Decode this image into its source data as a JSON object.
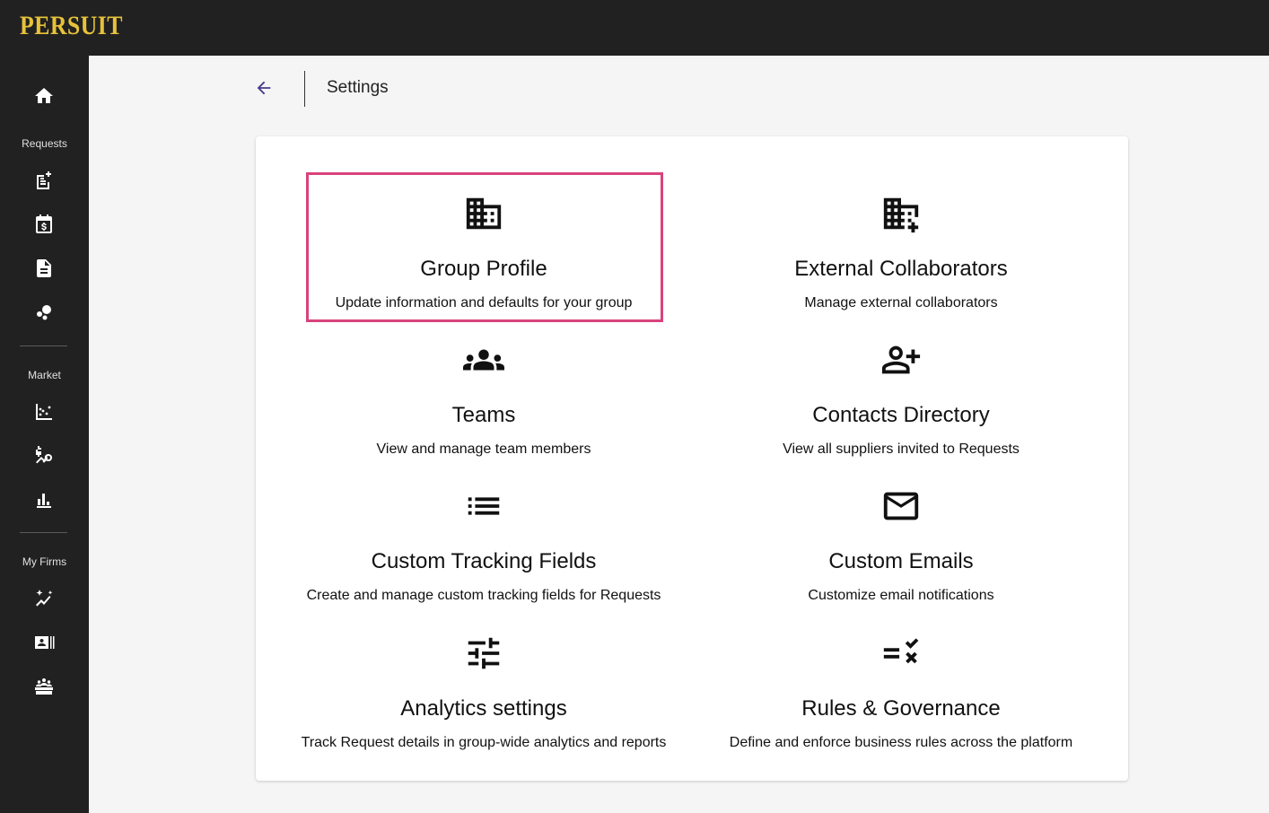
{
  "app": {
    "logo": "PERSUIT"
  },
  "sidebar": {
    "home_icon": "home-icon",
    "sections": [
      {
        "label": "Requests",
        "items": [
          "new-request-icon",
          "calendar-dollar-icon",
          "document-icon",
          "bubbles-icon"
        ]
      },
      {
        "label": "Market",
        "items": [
          "scatter-chart-icon",
          "market-search-icon",
          "bar-chart-icon"
        ]
      },
      {
        "label": "My Firms",
        "items": [
          "sparkle-trend-icon",
          "firm-card-icon",
          "firms-group-icon"
        ]
      }
    ]
  },
  "header": {
    "title": "Settings",
    "back_icon": "arrow-back-icon"
  },
  "tiles": [
    {
      "title": "Group Profile",
      "desc": "Update information and defaults for your group",
      "icon": "building-icon",
      "highlighted": true
    },
    {
      "title": "External Collaborators",
      "desc": "Manage external collaborators",
      "icon": "building-add-icon"
    },
    {
      "title": "Teams",
      "desc": "View and manage team members",
      "icon": "groups-icon"
    },
    {
      "title": "Contacts Directory",
      "desc": "View all suppliers invited to Requests",
      "icon": "person-add-icon"
    },
    {
      "title": "Custom Tracking Fields",
      "desc": "Create and manage custom tracking fields for Requests",
      "icon": "list-icon"
    },
    {
      "title": "Custom Emails",
      "desc": "Customize email notifications",
      "icon": "mail-icon"
    },
    {
      "title": "Analytics settings",
      "desc": "Track Request details in group-wide analytics and reports",
      "icon": "tune-icon"
    },
    {
      "title": "Rules & Governance",
      "desc": "Define and enforce business rules across the platform",
      "icon": "rule-icon"
    }
  ],
  "colors": {
    "accent": "#4b3a8c",
    "highlight": "#d9437d",
    "logo": "#e7c23a",
    "sidebar": "#212121"
  }
}
